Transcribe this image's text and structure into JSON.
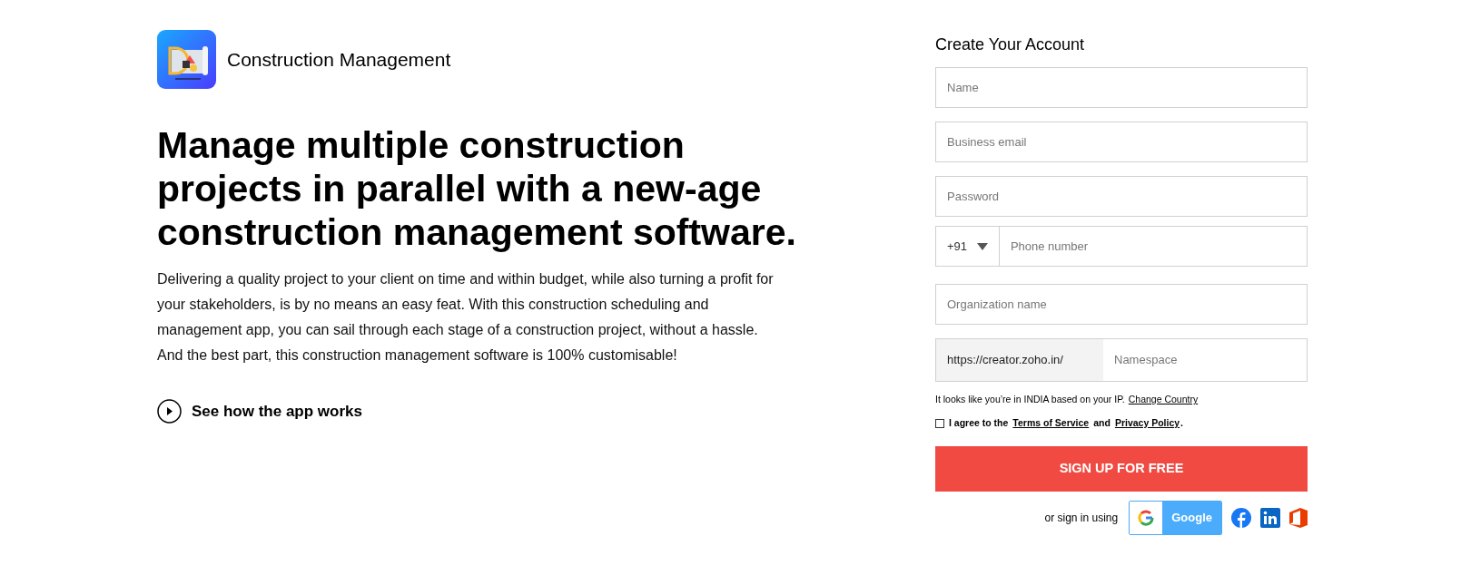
{
  "brand": {
    "name": "Construction Management"
  },
  "hero": {
    "heading": "Manage multiple construction projects in parallel with a new-age construction management software.",
    "body": "Delivering a quality project to your client on time and within budget, while also turning a profit for your stakeholders, is by no means an easy feat. With this construction scheduling and management app, you can sail through each stage of a construction project, without a hassle. And the best part, this construction management software is 100% customisable!",
    "video_link": "See how the app works"
  },
  "form": {
    "title": "Create Your Account",
    "name": {
      "placeholder": "Name"
    },
    "email": {
      "placeholder": "Business email"
    },
    "password": {
      "placeholder": "Password"
    },
    "phone": {
      "country_code": "+91",
      "placeholder": "Phone number"
    },
    "organization": {
      "placeholder": "Organization name"
    },
    "namespace": {
      "prefix": "https://creator.zoho.in/",
      "placeholder": "Namespace"
    },
    "location_note": "It looks like you’re in INDIA based on your IP.",
    "change_country": "Change Country",
    "agree": {
      "checked": false,
      "text_1": "I agree to the",
      "terms": "Terms of Service",
      "text_2": "and",
      "privacy": "Privacy Policy",
      "text_3": "."
    },
    "submit": "SIGN UP FOR FREE",
    "alt_signin": "or sign in using",
    "google": "Google"
  }
}
